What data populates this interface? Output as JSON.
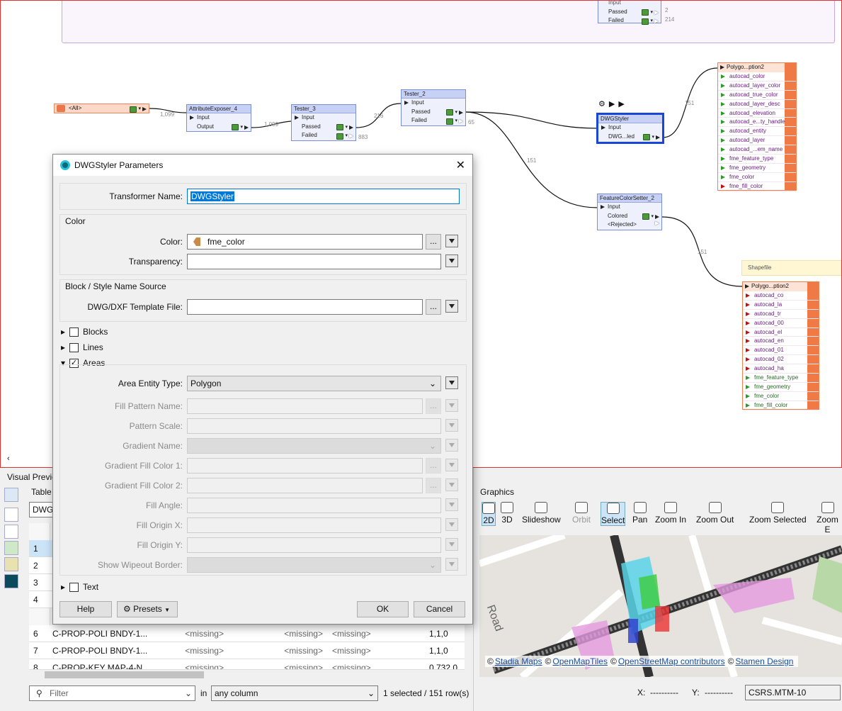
{
  "canvas": {
    "top_node": {
      "passed": "Passed",
      "failed": "Failed",
      "passed_count": "2",
      "failed_count": "214",
      "input": "Input"
    },
    "reader": {
      "label": "<All>",
      "count": "1,099"
    },
    "attribute_exposer": {
      "title": "AttributeExposer_4",
      "input": "Input",
      "output": "Output",
      "count": "1,099"
    },
    "tester3": {
      "title": "Tester_3",
      "input": "Input",
      "passed": "Passed",
      "failed": "Failed",
      "passed_count": "216",
      "failed_count": "883"
    },
    "tester2": {
      "title": "Tester_2",
      "input": "Input",
      "passed": "Passed",
      "failed": "Failed",
      "failed_count": "65",
      "passed_count": "151"
    },
    "dwgstyler": {
      "title": "DWGStyler",
      "input": "Input",
      "output": "DWG...led",
      "count": "151"
    },
    "featurecolorsetter": {
      "title": "FeatureColorSetter_2",
      "input": "Input",
      "colored": "Colored",
      "rejected": "<Rejected>",
      "count": "151"
    },
    "writer1": {
      "title": "Polygo...ption2",
      "attrs": [
        "autocad_color",
        "autocad_layer_color",
        "autocad_true_color",
        "autocad_layer_desc",
        "autocad_elevation",
        "autocad_e...ty_handle",
        "autocad_entity",
        "autocad_layer",
        "autocad_...em_name",
        "fme_feature_type",
        "fme_geometry",
        "fme_color",
        "fme_fill_color"
      ]
    },
    "writer2_caption": "Shapefile",
    "writer2": {
      "title": "Polygo...ption2",
      "attrs": [
        "autocad_co",
        "autocad_la",
        "autocad_tr",
        "autocad_00",
        "autocad_el",
        "autocad_en",
        "autocad_01",
        "autocad_02",
        "autocad_ha",
        "fme_feature_type",
        "fme_geometry",
        "fme_color",
        "fme_fill_color"
      ]
    }
  },
  "dialog": {
    "title": "DWGStyler Parameters",
    "transformer_name_label": "Transformer Name:",
    "transformer_name_value": "DWGStyler",
    "color_group": "Color",
    "color_label": "Color:",
    "color_value": "fme_color",
    "transparency_label": "Transparency:",
    "transparency_value": "",
    "block_group": "Block / Style Name Source",
    "template_label": "DWG/DXF Template File:",
    "template_value": "",
    "blocks": "Blocks",
    "lines": "Lines",
    "areas": "Areas",
    "area_entity_label": "Area Entity Type:",
    "area_entity_value": "Polygon",
    "fill_pattern_label": "Fill Pattern Name:",
    "pattern_scale_label": "Pattern Scale:",
    "gradient_name_label": "Gradient Name:",
    "gradient1_label": "Gradient Fill Color 1:",
    "gradient2_label": "Gradient Fill Color 2:",
    "fill_angle_label": "Fill Angle:",
    "fill_origin_x_label": "Fill Origin X:",
    "fill_origin_y_label": "Fill Origin Y:",
    "wipeout_label": "Show Wipeout Border:",
    "text": "Text",
    "help": "Help",
    "presets": "Presets",
    "ok": "OK",
    "cancel": "Cancel",
    "dots": "..."
  },
  "visual_preview": {
    "title": "Visual Previe",
    "table_tab": "Table",
    "dataset": "DWG",
    "rows": [
      {
        "n": "1"
      },
      {
        "n": "2"
      },
      {
        "n": "3"
      },
      {
        "n": "4"
      },
      {
        "n": "6",
        "c1": "C-PROP-POLI BNDY-1...",
        "c2": "<missing>",
        "c3": "<missing>",
        "c4": "<missing>",
        "c5": "1,1,0"
      },
      {
        "n": "7",
        "c1": "C-PROP-POLI BNDY-1...",
        "c2": "<missing>",
        "c3": "<missing>",
        "c4": "<missing>",
        "c5": "1,1,0"
      },
      {
        "n": "8",
        "c1": "C-PROP-KEY MAP-4-N...",
        "c2": "<missing>",
        "c3": "<missing>",
        "c4": "<missing>",
        "c5": "0.732,0"
      }
    ],
    "filter_placeholder": "Filter",
    "in_label": "in",
    "column_select": "any column",
    "status": "1 selected / 151 row(s)"
  },
  "graphics": {
    "title": "Graphics",
    "tools": [
      "2D",
      "3D",
      "Slideshow",
      "Orbit",
      "Select",
      "Pan",
      "Zoom In",
      "Zoom Out",
      "Zoom Selected",
      "Zoom E"
    ],
    "attribution": [
      "©",
      "Stadia Maps",
      "©",
      "OpenMapTiles",
      "©",
      "OpenStreetMap contributors",
      "©",
      "Stamen Design"
    ],
    "road_label": "Road",
    "x_label": "X:",
    "x_value": "----------",
    "y_label": "Y:",
    "y_value": "----------",
    "crs": "CSRS.MTM-10"
  }
}
